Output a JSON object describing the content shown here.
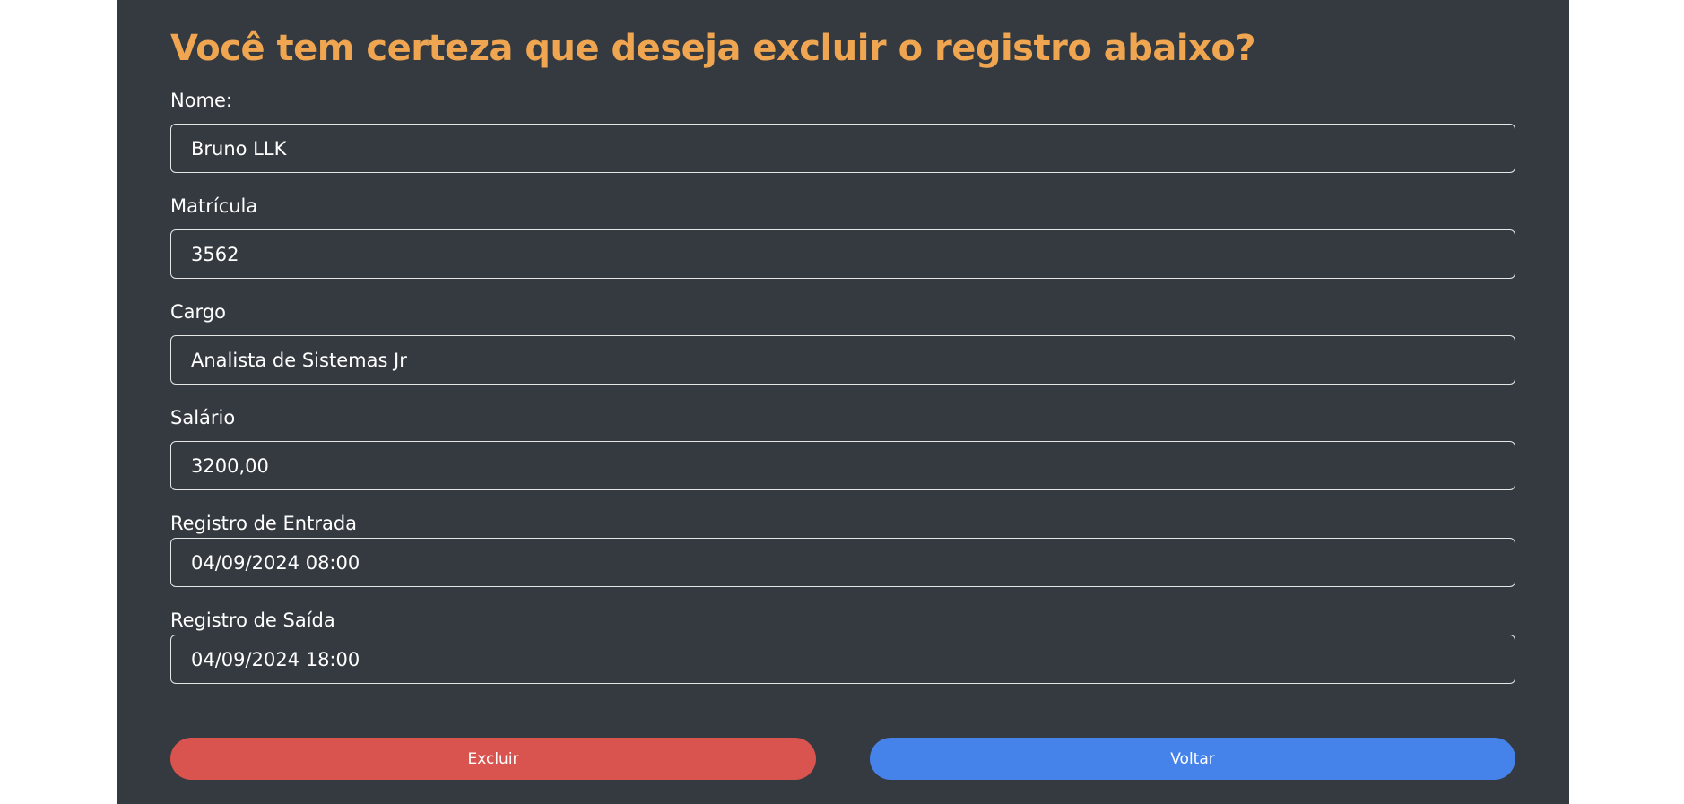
{
  "heading": "Você tem certeza que deseja excluir o registro abaixo?",
  "fields": {
    "nome": {
      "label": "Nome:",
      "value": "Bruno LLK"
    },
    "matricula": {
      "label": "Matrícula",
      "value": "3562"
    },
    "cargo": {
      "label": "Cargo",
      "value": "Analista de Sistemas Jr"
    },
    "salario": {
      "label": "Salário",
      "value": "3200,00"
    },
    "entrada": {
      "label": "Registro de Entrada",
      "value": "04/09/2024 08:00"
    },
    "saida": {
      "label": "Registro de Saída",
      "value": "04/09/2024 18:00"
    }
  },
  "actions": {
    "delete_label": "Excluir",
    "back_label": "Voltar"
  },
  "colors": {
    "heading": "#f0a650",
    "panel_bg": "#343a40",
    "delete": "#d9534f",
    "back": "#4583ea"
  }
}
